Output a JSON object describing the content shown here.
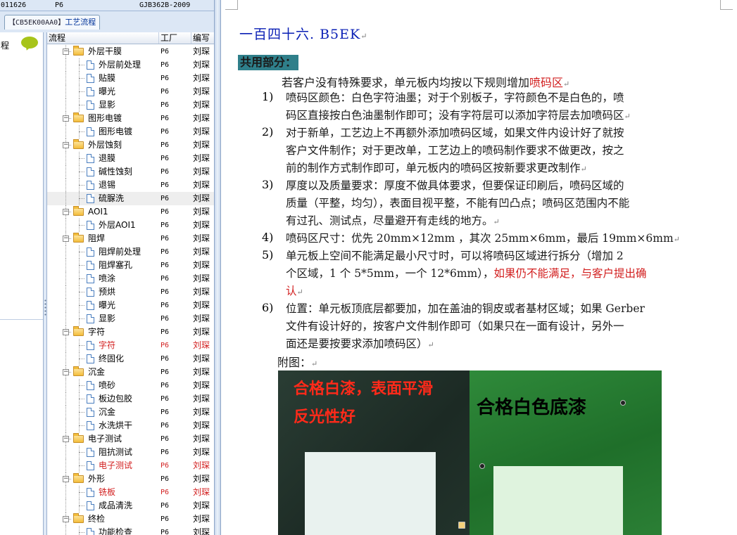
{
  "left_app": {
    "top_strip": {
      "code": "011626",
      "factory": "P6",
      "spec": "GJB362B-2009"
    },
    "tab": {
      "code": "【CB5EK00AA0】",
      "label": "工艺流程"
    },
    "side_label": "程",
    "grid": {
      "headers": [
        "流程",
        "工厂",
        "编写"
      ],
      "rows": [
        {
          "name": "外层干膜",
          "factory": "P6",
          "editor": "刘琛",
          "type": "folder",
          "red": false
        },
        {
          "name": "外层前处理",
          "factory": "P6",
          "editor": "刘琛",
          "type": "page",
          "red": false
        },
        {
          "name": "贴膜",
          "factory": "P6",
          "editor": "刘琛",
          "type": "page",
          "red": false
        },
        {
          "name": "曝光",
          "factory": "P6",
          "editor": "刘琛",
          "type": "page",
          "red": false
        },
        {
          "name": "显影",
          "factory": "P6",
          "editor": "刘琛",
          "type": "page",
          "red": false
        },
        {
          "name": "图形电镀",
          "factory": "P6",
          "editor": "刘琛",
          "type": "folder",
          "red": false
        },
        {
          "name": "图形电镀",
          "factory": "P6",
          "editor": "刘琛",
          "type": "page",
          "red": false
        },
        {
          "name": "外层蚀刻",
          "factory": "P6",
          "editor": "刘琛",
          "type": "folder",
          "red": false
        },
        {
          "name": "退膜",
          "factory": "P6",
          "editor": "刘琛",
          "type": "page",
          "red": false
        },
        {
          "name": "碱性蚀刻",
          "factory": "P6",
          "editor": "刘琛",
          "type": "page",
          "red": false
        },
        {
          "name": "退锡",
          "factory": "P6",
          "editor": "刘琛",
          "type": "page",
          "red": false
        },
        {
          "name": "硫脲洗",
          "factory": "P6",
          "editor": "刘琛",
          "type": "page",
          "red": false,
          "selected": true
        },
        {
          "name": "AOI1",
          "factory": "P6",
          "editor": "刘琛",
          "type": "folder",
          "red": false
        },
        {
          "name": "外层AOI1",
          "factory": "P6",
          "editor": "刘琛",
          "type": "page",
          "red": false
        },
        {
          "name": "阻焊",
          "factory": "P6",
          "editor": "刘琛",
          "type": "folder",
          "red": false
        },
        {
          "name": "阻焊前处理",
          "factory": "P6",
          "editor": "刘琛",
          "type": "page",
          "red": false
        },
        {
          "name": "阻焊塞孔",
          "factory": "P6",
          "editor": "刘琛",
          "type": "page",
          "red": false
        },
        {
          "name": "喷涂",
          "factory": "P6",
          "editor": "刘琛",
          "type": "page",
          "red": false
        },
        {
          "name": "预烘",
          "factory": "P6",
          "editor": "刘琛",
          "type": "page",
          "red": false
        },
        {
          "name": "曝光",
          "factory": "P6",
          "editor": "刘琛",
          "type": "page",
          "red": false
        },
        {
          "name": "显影",
          "factory": "P6",
          "editor": "刘琛",
          "type": "page",
          "red": false
        },
        {
          "name": "字符",
          "factory": "P6",
          "editor": "刘琛",
          "type": "folder",
          "red": false
        },
        {
          "name": "字符",
          "factory": "P6",
          "editor": "刘琛",
          "type": "page",
          "red": true
        },
        {
          "name": "终固化",
          "factory": "P6",
          "editor": "刘琛",
          "type": "page",
          "red": false
        },
        {
          "name": "沉金",
          "factory": "P6",
          "editor": "刘琛",
          "type": "folder",
          "red": false
        },
        {
          "name": "喷砂",
          "factory": "P6",
          "editor": "刘琛",
          "type": "page",
          "red": false
        },
        {
          "name": "板边包胶",
          "factory": "P6",
          "editor": "刘琛",
          "type": "page",
          "red": false
        },
        {
          "name": "沉金",
          "factory": "P6",
          "editor": "刘琛",
          "type": "page",
          "red": false
        },
        {
          "name": "水洗烘干",
          "factory": "P6",
          "editor": "刘琛",
          "type": "page",
          "red": false
        },
        {
          "name": "电子测试",
          "factory": "P6",
          "editor": "刘琛",
          "type": "folder",
          "red": false
        },
        {
          "name": "阻抗测试",
          "factory": "P6",
          "editor": "刘琛",
          "type": "page",
          "red": false
        },
        {
          "name": "电子测试",
          "factory": "P6",
          "editor": "刘琛",
          "type": "page",
          "red": true
        },
        {
          "name": "外形",
          "factory": "P6",
          "editor": "刘琛",
          "type": "folder",
          "red": false
        },
        {
          "name": "铣板",
          "factory": "P6",
          "editor": "刘琛",
          "type": "page",
          "red": true
        },
        {
          "name": "成品清洗",
          "factory": "P6",
          "editor": "刘琛",
          "type": "page",
          "red": false
        },
        {
          "name": "终检",
          "factory": "P6",
          "editor": "刘琛",
          "type": "folder",
          "red": false
        },
        {
          "name": "功能检查",
          "factory": "P6",
          "editor": "刘琛",
          "type": "page",
          "red": false
        }
      ]
    }
  },
  "doc": {
    "title": "一百四十六. B5EK",
    "common_label": "共用部分：",
    "intro_text": "若客户没有特殊要求，单元板内均按以下规则增加",
    "intro_highlight": "喷码区",
    "items": [
      {
        "num": "1)",
        "lines": [
          "喷码区颜色：白色字符油墨；对于个别板子，字符颜色不是白色的，喷",
          "码区直接按白色油墨制作即可；没有字符层可以添加字符层去加喷码区"
        ],
        "red_tail": ""
      },
      {
        "num": "2)",
        "lines": [
          "对于新单，工艺边上不再额外添加喷码区域，如果文件内设计好了就按",
          "客户文件制作；对于更改单，工艺边上的喷码制作要求不做更改，按之",
          "前的制作方式制作即可，单元板内的喷码区按新要求更改制作"
        ],
        "red_tail": ""
      },
      {
        "num": "3)",
        "lines": [
          "厚度以及质量要求：厚度不做具体要求，但要保证印刷后，喷码区域的",
          "质量（平整，均匀），表面目视平整，不能有凹凸点；喷码区范围内不能",
          "有过孔、测试点，尽量避开有走线的地方。"
        ],
        "red_tail": ""
      },
      {
        "num": "4)",
        "lines": [
          "喷码区尺寸：优先 20mm×12mm ，其次 25mm×6mm，最后 19mm×6mm"
        ],
        "red_tail": ""
      },
      {
        "num": "5)",
        "lines": [
          "单元板上空间不能满足最小尺寸时，可以将喷码区域进行拆分（增加 2",
          "个区域，1 个 5*5mm，一个 12*6mm），"
        ],
        "red_tail": "如果仍不能满足，与客户提出确",
        "red_tail2": "认"
      },
      {
        "num": "6)",
        "lines": [
          "位置：单元板顶底层都要加，加在盖油的铜皮或者基材区域；如果 Gerber",
          "文件有设计好的，按客户文件制作即可（如果只在一面有设计，另外一",
          "面还是要按要求添加喷码区）"
        ],
        "red_tail": ""
      }
    ],
    "appendix_label": "附图：",
    "photo_captions": {
      "left_line1": "合格白漆，表面平滑",
      "left_line2": "反光性好",
      "right": "合格白色底漆"
    }
  },
  "colors": {
    "title": "#0a1fb5",
    "highlight_red": "#d21e1e",
    "common_bg": "#2f7f8a",
    "caption_red": "#ff2a1a"
  }
}
